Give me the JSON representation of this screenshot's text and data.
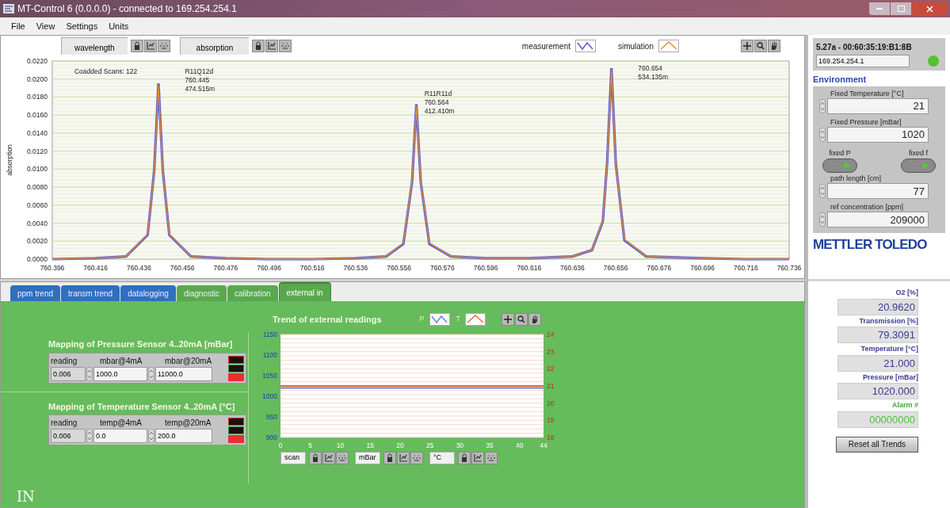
{
  "window": {
    "title": "MT-Control 6 (0.0.0.0) - connected to 169.254.254.1"
  },
  "menu": [
    "File",
    "View",
    "Settings",
    "Units"
  ],
  "spectrum": {
    "x_axis_name": "wavelength",
    "y_axis_name": "absorption",
    "chart_data": {
      "type": "line",
      "ylabel": "absorption",
      "x": [
        760.396,
        760.416,
        760.43,
        760.44,
        760.443,
        760.445,
        760.447,
        760.45,
        760.46,
        760.476,
        760.496,
        760.516,
        760.536,
        760.55,
        760.558,
        760.562,
        760.564,
        760.566,
        760.57,
        760.58,
        760.596,
        760.616,
        760.636,
        760.645,
        760.65,
        760.652,
        760.654,
        760.656,
        760.66,
        760.67,
        760.696,
        760.716,
        760.736
      ],
      "grid": true,
      "series": [
        {
          "name": "measurement",
          "color": "#5a5acf",
          "values": [
            0.0,
            0.0001,
            0.0003,
            0.0027,
            0.0098,
            0.0195,
            0.0098,
            0.0027,
            0.0003,
            0.0001,
            0.0,
            0.0,
            0.0001,
            0.0003,
            0.0017,
            0.0086,
            0.0172,
            0.0086,
            0.0017,
            0.0003,
            0.0001,
            0.0001,
            0.0003,
            0.001,
            0.0042,
            0.0106,
            0.0212,
            0.0106,
            0.0021,
            0.0003,
            0.0001,
            0.0,
            0.0
          ]
        },
        {
          "name": "simulation",
          "color": "#e8902a",
          "values": [
            0.0,
            0.0001,
            0.0003,
            0.0028,
            0.0097,
            0.0193,
            0.0097,
            0.0028,
            0.0003,
            0.0001,
            0.0,
            0.0,
            0.0001,
            0.0003,
            0.0018,
            0.0087,
            0.017,
            0.0087,
            0.0018,
            0.0003,
            0.0001,
            0.0001,
            0.0003,
            0.001,
            0.0043,
            0.0105,
            0.021,
            0.0105,
            0.0022,
            0.0003,
            0.0001,
            0.0,
            0.0
          ]
        }
      ],
      "xlim": [
        760.396,
        760.736
      ],
      "ylim": [
        0,
        0.022
      ],
      "xticks": [
        {
          "value": 760.396,
          "label": "760.396"
        },
        {
          "value": 760.416,
          "label": "760.416"
        },
        {
          "value": 760.436,
          "label": "760.436"
        },
        {
          "value": 760.456,
          "label": "760.456"
        },
        {
          "value": 760.476,
          "label": "760.476"
        },
        {
          "value": 760.496,
          "label": "760.496"
        },
        {
          "value": 760.516,
          "label": "760.516"
        },
        {
          "value": 760.536,
          "label": "760.536"
        },
        {
          "value": 760.556,
          "label": "760.556"
        },
        {
          "value": 760.576,
          "label": "760.576"
        },
        {
          "value": 760.596,
          "label": "760.596"
        },
        {
          "value": 760.616,
          "label": "760.616"
        },
        {
          "value": 760.636,
          "label": "760.636"
        },
        {
          "value": 760.656,
          "label": "760.656"
        },
        {
          "value": 760.676,
          "label": "760.676"
        },
        {
          "value": 760.696,
          "label": "760.696"
        },
        {
          "value": 760.716,
          "label": "760.716"
        },
        {
          "value": 760.736,
          "label": "760.736"
        }
      ],
      "yticks": [
        {
          "value": 0,
          "label": "0.0000"
        },
        {
          "value": 0.002,
          "label": "0.0020"
        },
        {
          "value": 0.004,
          "label": "0.0040"
        },
        {
          "value": 0.006,
          "label": "0.0060"
        },
        {
          "value": 0.008,
          "label": "0.0080"
        },
        {
          "value": 0.01,
          "label": "0.0100"
        },
        {
          "value": 0.012,
          "label": "0.0120"
        },
        {
          "value": 0.014,
          "label": "0.0140"
        },
        {
          "value": 0.016,
          "label": "0.0160"
        },
        {
          "value": 0.018,
          "label": "0.0180"
        },
        {
          "value": 0.02,
          "label": "0.0200"
        },
        {
          "value": 0.022,
          "label": "0.0220"
        }
      ],
      "annotations": [
        "Coadded Scans: 122",
        "R11Q12d\n760.445\n474.515m",
        "R11R11d\n760.564\n412.410m",
        "760.654\n534.135m"
      ]
    }
  },
  "device": {
    "id": "5.27a - 00:60:35:19:B1:8B",
    "address": "169.254.254.1",
    "connected": true
  },
  "environment": {
    "title": "Environment",
    "fields_top": [
      {
        "label": "Fixed Temperature [°C]",
        "value": "21"
      },
      {
        "label": "Fixed Pressure [mBar]",
        "value": "1020"
      }
    ],
    "switches": [
      {
        "label": "fixed P",
        "on": true
      },
      {
        "label": "fixed f",
        "on": true
      }
    ],
    "fields_bottom": [
      {
        "label": "path length [cm]",
        "value": "77"
      },
      {
        "label": "ref concentration [ppm]",
        "value": "209000"
      }
    ]
  },
  "logo": "METTLER TOLEDO",
  "readouts": [
    {
      "label": "O2 [%]",
      "value": "20.9620",
      "kind": "normal"
    },
    {
      "label": "Transmission [%]",
      "value": "79.3091",
      "kind": "normal"
    },
    {
      "label": "Temperature [°C]",
      "value": "21.000",
      "kind": "normal"
    },
    {
      "label": "Pressure [mBar]",
      "value": "1020.000",
      "kind": "normal"
    },
    {
      "label": "Alarm #",
      "value": "00000000",
      "kind": "alarm"
    }
  ],
  "reset_button": "Reset all Trends",
  "tabs": [
    {
      "label": "ppm trend",
      "selected": false,
      "color": "#2f6fc0"
    },
    {
      "label": "transm trend",
      "selected": false,
      "color": "#2f6fc0"
    },
    {
      "label": "datalogging",
      "selected": false,
      "color": "#2f6fc0"
    },
    {
      "label": "diagnostic",
      "selected": false,
      "color": "#5aa84e"
    },
    {
      "label": "calibration",
      "selected": false,
      "color": "#5aa84e"
    },
    {
      "label": "external in",
      "selected": true,
      "color": "#5aa84e"
    }
  ],
  "sensors": [
    {
      "title": "Mapping of Pressure Sensor 4..20mA [mBar]",
      "columns": [
        "reading",
        "mbar@4mA",
        "mbar@20mA"
      ],
      "reading": "0.006",
      "low": "1000.0",
      "high": "11000.0",
      "lights": [
        {
          "color": "#d03030",
          "on": false
        },
        {
          "color": "#30a040",
          "on": false
        },
        {
          "color": "#e83030",
          "on": true
        }
      ]
    },
    {
      "title": "Mapping of Temperature Sensor 4..20mA [°C]",
      "columns": [
        "reading",
        "temp@4mA",
        "temp@20mA"
      ],
      "reading": "0.006",
      "low": "0.0",
      "high": "200.0",
      "lights": [
        {
          "color": "#d03030",
          "on": false
        },
        {
          "color": "#30a040",
          "on": false
        },
        {
          "color": "#e83030",
          "on": true
        }
      ]
    }
  ],
  "trend": {
    "title": "Trend of external readings",
    "chart_data": {
      "type": "line",
      "x": [
        0,
        44
      ],
      "grid": true,
      "series": [
        {
          "name": "P",
          "color": "#6a80e0",
          "values": [
            1020,
            1020
          ]
        },
        {
          "name": "T",
          "color": "#e86a40",
          "axis": "y2",
          "values": [
            21,
            21
          ]
        }
      ],
      "xlim": [
        0,
        44
      ],
      "ylim": [
        900,
        1150
      ],
      "y2lim": [
        18,
        24
      ],
      "xticks": [
        0,
        5,
        10,
        15,
        20,
        25,
        30,
        35,
        40,
        44
      ],
      "yticks": [
        900,
        950,
        1000,
        1050,
        1100,
        1150
      ],
      "y2ticks": [
        18,
        19,
        20,
        21,
        22,
        23,
        24
      ]
    },
    "axis_units": [
      "scan",
      "mBar",
      "°C"
    ]
  },
  "panel_label": "IN"
}
